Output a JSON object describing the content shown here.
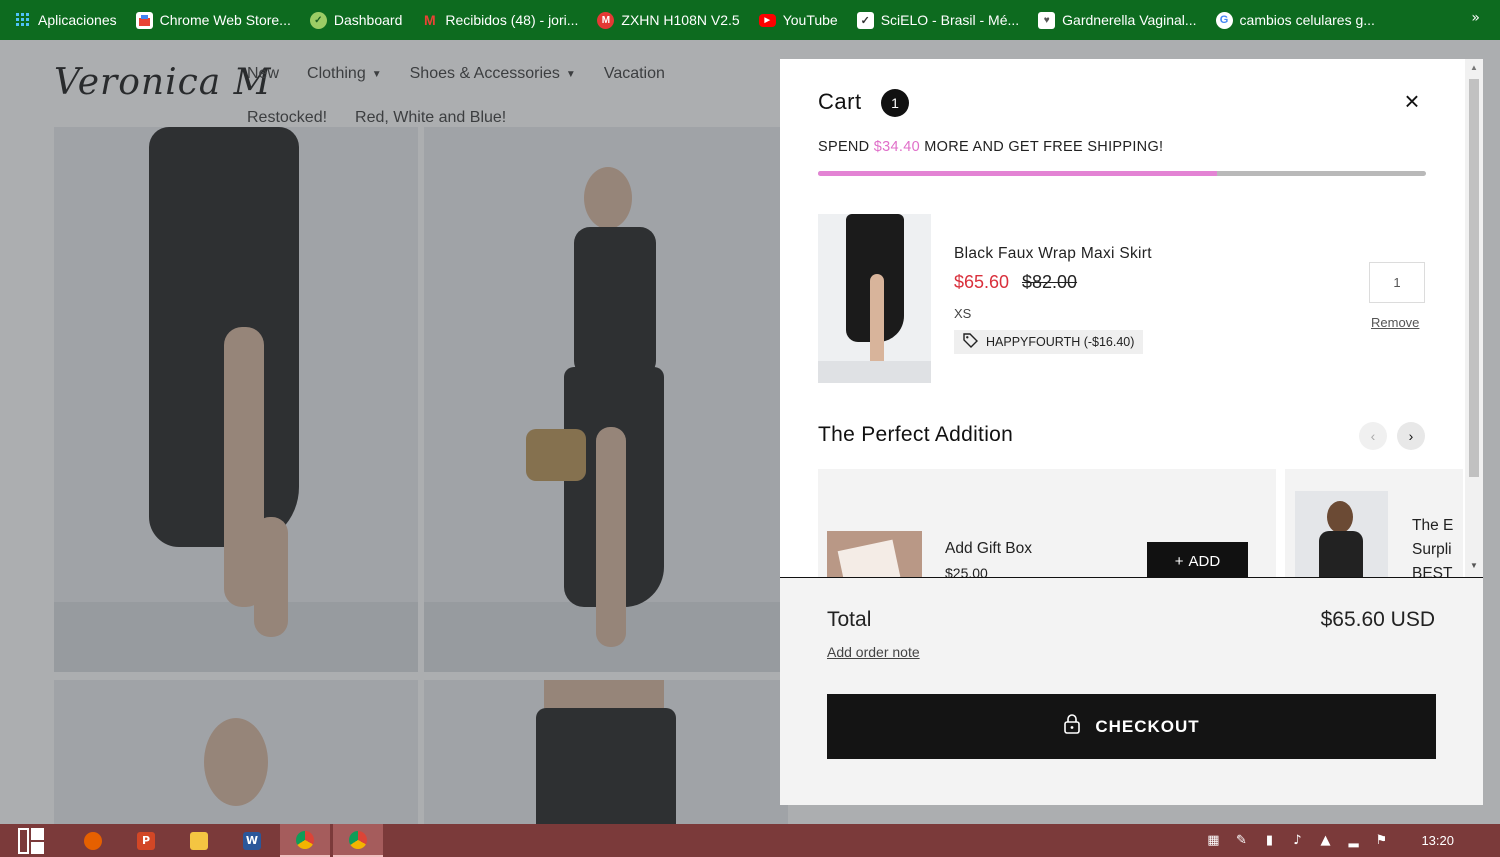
{
  "bookmarks": {
    "items": [
      {
        "label": "Aplicaciones",
        "icon": "apps-grid-icon",
        "color": "#4285f4"
      },
      {
        "label": "Chrome Web Store...",
        "icon": "web-store-icon",
        "color": "#e94235"
      },
      {
        "label": "Dashboard",
        "icon": "dashboard-icon",
        "color": "#7cb342"
      },
      {
        "label": "Recibidos (48) - jori...",
        "icon": "gmail-icon",
        "color": "#ea4335"
      },
      {
        "label": "ZXHN H108N V2.5",
        "icon": "router-icon",
        "color": "#e53935"
      },
      {
        "label": "YouTube",
        "icon": "youtube-icon",
        "color": "#ff0000"
      },
      {
        "label": "SciELO - Brasil - Mé...",
        "icon": "scielo-icon",
        "color": "#ffffff"
      },
      {
        "label": "Gardnerella Vaginal...",
        "icon": "page-icon",
        "color": "#ffffff"
      },
      {
        "label": "cambios celulares g...",
        "icon": "google-icon",
        "color": "#ffffff"
      }
    ],
    "more": "»"
  },
  "site": {
    "logo": "Veronica M",
    "nav_row1": [
      "New",
      "Clothing",
      "Shoes & Accessories",
      "Vacation"
    ],
    "nav_row2": [
      "Restocked!",
      "Red, White and Blue!"
    ]
  },
  "cart": {
    "title": "Cart",
    "count": "1",
    "close": "×",
    "shipping_prefix": "SPEND ",
    "shipping_amount": "$34.40",
    "shipping_suffix": " MORE AND GET FREE SHIPPING!",
    "shipping_progress_fraction": 0.656,
    "accent_color": "#e383d4",
    "item": {
      "name": "Black Faux Wrap Maxi Skirt",
      "price": "$65.60",
      "compare_price": "$82.00",
      "variant": "XS",
      "discount": "HAPPYFOURTH (-$16.40)",
      "quantity": "1",
      "remove": "Remove",
      "sale_color": "#d9303c"
    },
    "upsell": {
      "title": "The Perfect Addition",
      "prev": "‹",
      "next": "›",
      "gift_name": "Add Gift Box",
      "gift_price": "$25.00",
      "add_label": "ADD",
      "add_plus": "+",
      "next_product_line1": "The E",
      "next_product_line2": "Surpli",
      "next_product_line3": "BEST"
    },
    "total_label": "Total",
    "total_value": "$65.60 USD",
    "order_note": "Add order note",
    "checkout": "CHECKOUT"
  },
  "taskbar": {
    "clock": "13:20"
  }
}
